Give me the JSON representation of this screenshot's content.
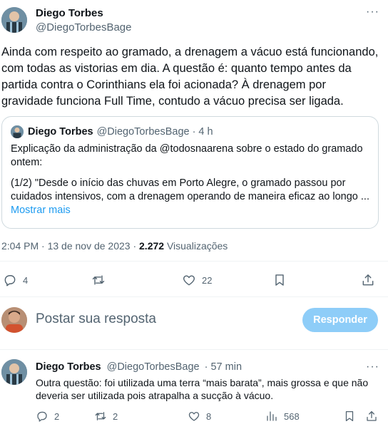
{
  "tweet": {
    "author_name": "Diego Torbes",
    "author_handle": "@DiegoTorbesBage",
    "more": "···",
    "text": "Ainda com respeito ao gramado, a drenagem a vácuo está funcionando, com todas as vistorias em dia. A questão é: quanto tempo antes da partida contra o Corinthians ela foi acionada? À drenagem por gravidade funciona Full Time, contudo a vácuo precisa ser ligada.",
    "quote": {
      "author_name": "Diego Torbes",
      "author_handle": "@DiegoTorbesBage",
      "time": "· 4 h",
      "line1": "Explicação da administração da @todosnaarena sobre o estado do gramado ontem:",
      "line2": "(1/2) \"Desde o início das chuvas em Porto Alegre, o gramado passou por cuidados intensivos, com a drenagem operando de maneira eficaz ao longo ...",
      "show_more": "Mostrar mais"
    },
    "timestamp": "2:04 PM · 13 de nov de 2023 ·",
    "views_count": "2.272",
    "views_label": "Visualizações",
    "actions": {
      "replies": "4",
      "retweets": "",
      "likes": "22"
    }
  },
  "reply_box": {
    "placeholder": "Postar sua resposta",
    "button_label": "Responder"
  },
  "reply": {
    "author_name": "Diego Torbes",
    "author_handle": "@DiegoTorbesBage",
    "time": "· 57 min",
    "text": "Outra questão: foi utilizada uma terra “mais barata”, mais grossa e que não deveria ser utilizada pois atrapalha a sucção à vácuo.",
    "more": "···",
    "actions": {
      "replies": "2",
      "retweets": "2",
      "likes": "8",
      "views": "568"
    }
  },
  "colors": {
    "accent": "#1d9bf0",
    "button_disabled": "#8ecdf8",
    "text_muted": "#536471"
  },
  "icons": [
    "more-icon",
    "reply-icon",
    "retweet-icon",
    "like-icon",
    "bookmark-icon",
    "share-icon",
    "views-icon"
  ]
}
